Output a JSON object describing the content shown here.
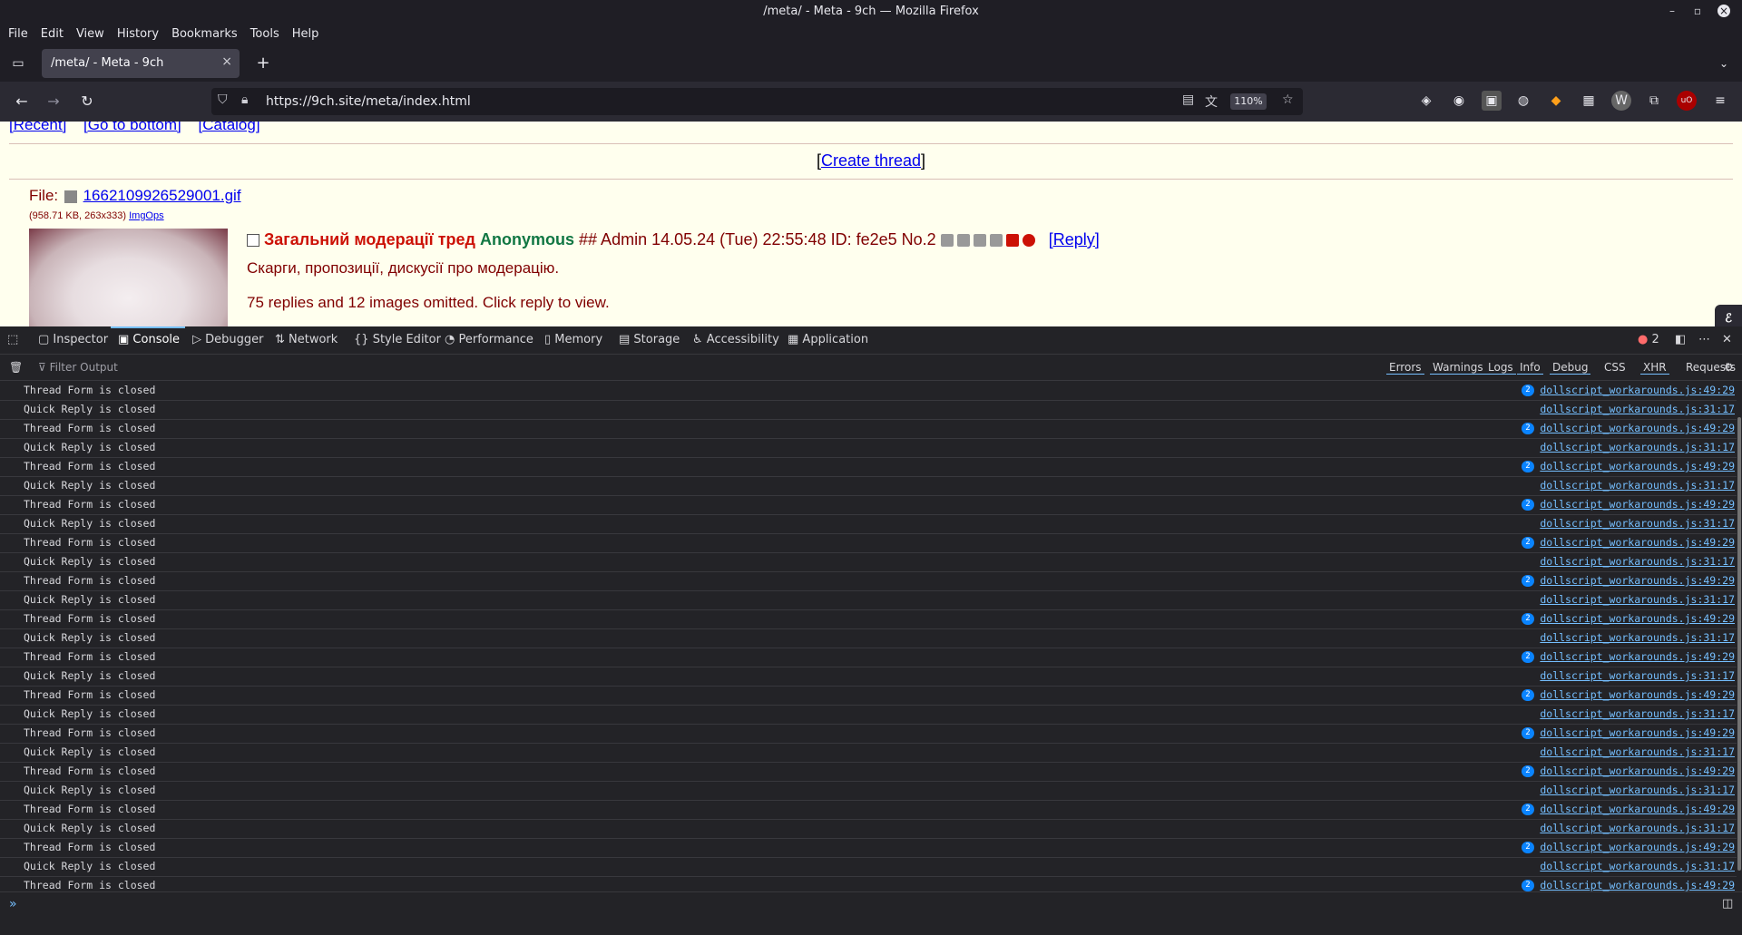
{
  "window": {
    "title": "/meta/ - Meta - 9ch — Mozilla Firefox"
  },
  "menu": [
    "File",
    "Edit",
    "View",
    "History",
    "Bookmarks",
    "Tools",
    "Help"
  ],
  "tab": {
    "label": "/meta/ - Meta - 9ch"
  },
  "address": {
    "url": "https://9ch.site/meta/index.html",
    "zoom": "110%"
  },
  "page": {
    "nav": {
      "recent": "[Recent]",
      "bottom": "[Go to bottom]",
      "catalog": "[Catalog]"
    },
    "create_thread": "Create thread",
    "file_label": "File:",
    "file_name": "1662109926529001.gif",
    "file_info": "(958.71 KB, 263x333)",
    "imgops": "ImgOps",
    "subject": "Загальний модерації тред",
    "name": "Anonymous",
    "capcode": "## Admin",
    "datetime": "14.05.24 (Tue) 22:55:48",
    "id": "ID: fe2e5",
    "number": "No.2",
    "reply": "[Reply]",
    "message": "Скарги, пропозиції, дискусії про модерацію.",
    "omitted": "75 replies and 12 images omitted. Click reply to view."
  },
  "devtools": {
    "tabs": [
      "Inspector",
      "Console",
      "Debugger",
      "Network",
      "Style Editor",
      "Performance",
      "Memory",
      "Storage",
      "Accessibility",
      "Application"
    ],
    "error_count": "2",
    "filter_placeholder": "Filter Output",
    "filters": [
      "Errors",
      "Warnings",
      "Logs",
      "Info",
      "Debug",
      "CSS",
      "XHR",
      "Requests"
    ],
    "rows": [
      {
        "msg": "Thread Form is closed",
        "src": "dollscript_workarounds.js:49:29",
        "badge": "2"
      },
      {
        "msg": "Quick Reply is closed",
        "src": "dollscript_workarounds.js:31:17",
        "badge": ""
      },
      {
        "msg": "Thread Form is closed",
        "src": "dollscript_workarounds.js:49:29",
        "badge": "2"
      },
      {
        "msg": "Quick Reply is closed",
        "src": "dollscript_workarounds.js:31:17",
        "badge": ""
      },
      {
        "msg": "Thread Form is closed",
        "src": "dollscript_workarounds.js:49:29",
        "badge": "2"
      },
      {
        "msg": "Quick Reply is closed",
        "src": "dollscript_workarounds.js:31:17",
        "badge": ""
      },
      {
        "msg": "Thread Form is closed",
        "src": "dollscript_workarounds.js:49:29",
        "badge": "2"
      },
      {
        "msg": "Quick Reply is closed",
        "src": "dollscript_workarounds.js:31:17",
        "badge": ""
      },
      {
        "msg": "Thread Form is closed",
        "src": "dollscript_workarounds.js:49:29",
        "badge": "2"
      },
      {
        "msg": "Quick Reply is closed",
        "src": "dollscript_workarounds.js:31:17",
        "badge": ""
      },
      {
        "msg": "Thread Form is closed",
        "src": "dollscript_workarounds.js:49:29",
        "badge": "2"
      },
      {
        "msg": "Quick Reply is closed",
        "src": "dollscript_workarounds.js:31:17",
        "badge": ""
      },
      {
        "msg": "Thread Form is closed",
        "src": "dollscript_workarounds.js:49:29",
        "badge": "2"
      },
      {
        "msg": "Quick Reply is closed",
        "src": "dollscript_workarounds.js:31:17",
        "badge": ""
      },
      {
        "msg": "Thread Form is closed",
        "src": "dollscript_workarounds.js:49:29",
        "badge": "2"
      },
      {
        "msg": "Quick Reply is closed",
        "src": "dollscript_workarounds.js:31:17",
        "badge": ""
      },
      {
        "msg": "Thread Form is closed",
        "src": "dollscript_workarounds.js:49:29",
        "badge": "2"
      },
      {
        "msg": "Quick Reply is closed",
        "src": "dollscript_workarounds.js:31:17",
        "badge": ""
      },
      {
        "msg": "Thread Form is closed",
        "src": "dollscript_workarounds.js:49:29",
        "badge": "2"
      },
      {
        "msg": "Quick Reply is closed",
        "src": "dollscript_workarounds.js:31:17",
        "badge": ""
      },
      {
        "msg": "Thread Form is closed",
        "src": "dollscript_workarounds.js:49:29",
        "badge": "2"
      },
      {
        "msg": "Quick Reply is closed",
        "src": "dollscript_workarounds.js:31:17",
        "badge": ""
      },
      {
        "msg": "Thread Form is closed",
        "src": "dollscript_workarounds.js:49:29",
        "badge": "2"
      },
      {
        "msg": "Quick Reply is closed",
        "src": "dollscript_workarounds.js:31:17",
        "badge": ""
      },
      {
        "msg": "Thread Form is closed",
        "src": "dollscript_workarounds.js:49:29",
        "badge": "2"
      },
      {
        "msg": "Quick Reply is closed",
        "src": "dollscript_workarounds.js:31:17",
        "badge": ""
      },
      {
        "msg": "Thread Form is closed",
        "src": "dollscript_workarounds.js:49:29",
        "badge": "2"
      }
    ]
  }
}
